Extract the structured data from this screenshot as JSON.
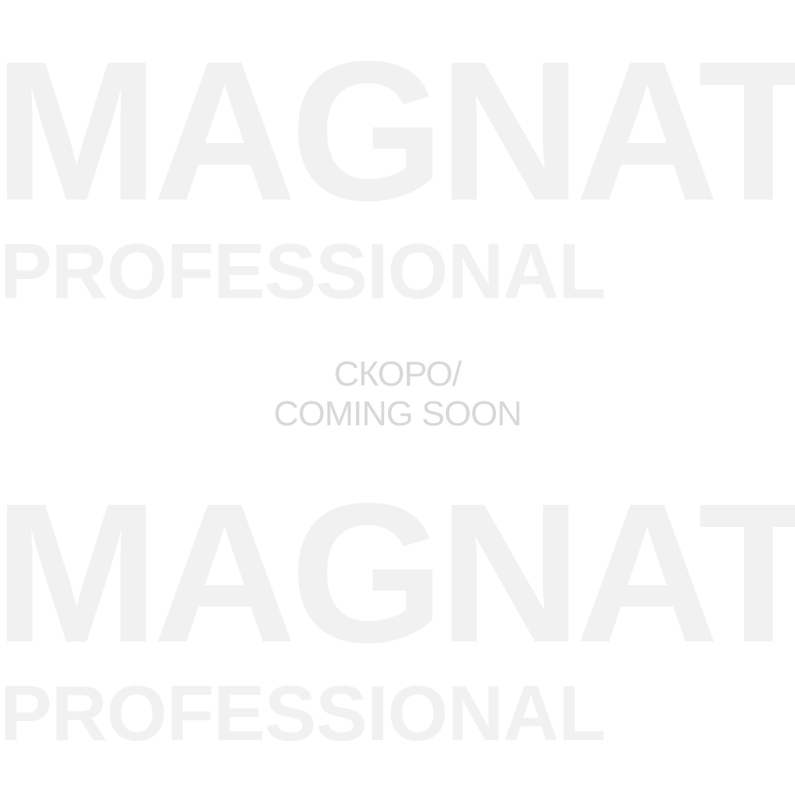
{
  "watermark": {
    "brand": "MAGNAT",
    "tagline": "PROFESSIONAL"
  },
  "message": {
    "line1": "СКОРО/",
    "line2": "COMING SOON"
  },
  "colors": {
    "background": "#ffffff",
    "watermark_text": "#f1f1f1",
    "message_text": "#d8d8d8"
  }
}
